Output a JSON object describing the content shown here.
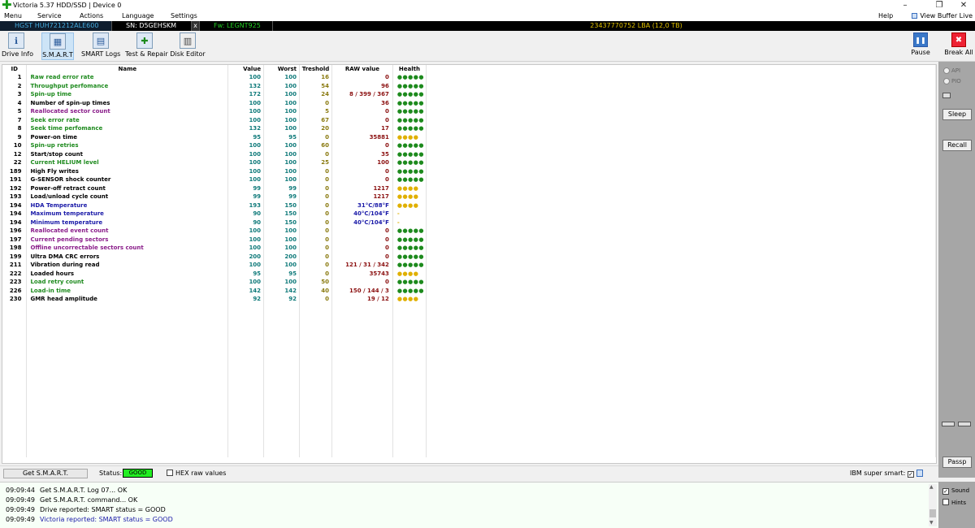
{
  "window": {
    "title": "Victoria 5.37 HDD/SSD | Device 0",
    "controls": {
      "minimize": "–",
      "maximize": "❐",
      "close": "✕"
    }
  },
  "menu": {
    "items": [
      "Menu",
      "Service",
      "Actions",
      "Language",
      "Settings"
    ],
    "help": "Help",
    "view_buffer": "View Buffer Live"
  },
  "device": {
    "model": "HGST HUH721212ALE600",
    "serial": "SN: D5GEHSKM",
    "close": "x",
    "firmware": "Fw: LEGNT925",
    "capacity": "23437770752 LBA (12,0 TB)"
  },
  "toolbar": {
    "buttons": [
      "Drive Info",
      "S.M.A.R.T",
      "SMART Logs",
      "Test & Repair",
      "Disk Editor"
    ],
    "pause": "Pause",
    "break_all": "Break All"
  },
  "table": {
    "headers": [
      "ID",
      "Name",
      "Value",
      "Worst",
      "Treshold",
      "RAW value",
      "Health"
    ],
    "rows": [
      {
        "id": "1",
        "name": "Raw read error rate",
        "value": "100",
        "worst": "100",
        "treshold": "16",
        "raw": "0",
        "health": "●●●●●"
      },
      {
        "id": "2",
        "name": "Throughput perfomance",
        "value": "132",
        "worst": "100",
        "treshold": "54",
        "raw": "96",
        "health": "●●●●●"
      },
      {
        "id": "3",
        "name": "Spin-up time",
        "value": "172",
        "worst": "100",
        "treshold": "24",
        "raw": "8 / 399 / 367",
        "health": "●●●●●"
      },
      {
        "id": "4",
        "name": "Number of spin-up times",
        "value": "100",
        "worst": "100",
        "treshold": "0",
        "raw": "36",
        "health": "●●●●●"
      },
      {
        "id": "5",
        "name": "Reallocated sector count",
        "value": "100",
        "worst": "100",
        "treshold": "5",
        "raw": "0",
        "health": "●●●●●"
      },
      {
        "id": "7",
        "name": "Seek error rate",
        "value": "100",
        "worst": "100",
        "treshold": "67",
        "raw": "0",
        "health": "●●●●●"
      },
      {
        "id": "8",
        "name": "Seek time perfomance",
        "value": "132",
        "worst": "100",
        "treshold": "20",
        "raw": "17",
        "health": "●●●●●"
      },
      {
        "id": "9",
        "name": "Power-on time",
        "value": "95",
        "worst": "95",
        "treshold": "0",
        "raw": "35881",
        "health": "●●●●"
      },
      {
        "id": "10",
        "name": "Spin-up retries",
        "value": "100",
        "worst": "100",
        "treshold": "60",
        "raw": "0",
        "health": "●●●●●"
      },
      {
        "id": "12",
        "name": "Start/stop count",
        "value": "100",
        "worst": "100",
        "treshold": "0",
        "raw": "35",
        "health": "●●●●●"
      },
      {
        "id": "22",
        "name": "Current HELIUM level",
        "value": "100",
        "worst": "100",
        "treshold": "25",
        "raw": "100",
        "health": "●●●●●"
      },
      {
        "id": "189",
        "name": "High Fly writes",
        "value": "100",
        "worst": "100",
        "treshold": "0",
        "raw": "0",
        "health": "●●●●●"
      },
      {
        "id": "191",
        "name": "G-SENSOR shock counter",
        "value": "100",
        "worst": "100",
        "treshold": "0",
        "raw": "0",
        "health": "●●●●●"
      },
      {
        "id": "192",
        "name": "Power-off retract count",
        "value": "99",
        "worst": "99",
        "treshold": "0",
        "raw": "1217",
        "health": "●●●●"
      },
      {
        "id": "193",
        "name": "Load/unload cycle count",
        "value": "99",
        "worst": "99",
        "treshold": "0",
        "raw": "1217",
        "health": "●●●●"
      },
      {
        "id": "194",
        "name": "HDA Temperature",
        "value": "193",
        "worst": "150",
        "treshold": "0",
        "raw": "31°C/88°F",
        "health": "●●●●"
      },
      {
        "id": "194",
        "name": "Maximum temperature",
        "value": "90",
        "worst": "150",
        "treshold": "0",
        "raw": "40°C/104°F",
        "health": "-"
      },
      {
        "id": "194",
        "name": "Minimum temperature",
        "value": "90",
        "worst": "150",
        "treshold": "0",
        "raw": "40°C/104°F",
        "health": "-"
      },
      {
        "id": "196",
        "name": "Reallocated event count",
        "value": "100",
        "worst": "100",
        "treshold": "0",
        "raw": "0",
        "health": "●●●●●"
      },
      {
        "id": "197",
        "name": "Current pending sectors",
        "value": "100",
        "worst": "100",
        "treshold": "0",
        "raw": "0",
        "health": "●●●●●"
      },
      {
        "id": "198",
        "name": "Offline uncorrectable sectors count",
        "value": "100",
        "worst": "100",
        "treshold": "0",
        "raw": "0",
        "health": "●●●●●"
      },
      {
        "id": "199",
        "name": "Ultra DMA CRC errors",
        "value": "200",
        "worst": "200",
        "treshold": "0",
        "raw": "0",
        "health": "●●●●●"
      },
      {
        "id": "211",
        "name": "Vibration during read",
        "value": "100",
        "worst": "100",
        "treshold": "0",
        "raw": "121 / 31 / 342",
        "health": "●●●●●"
      },
      {
        "id": "222",
        "name": "Loaded hours",
        "value": "95",
        "worst": "95",
        "treshold": "0",
        "raw": "35743",
        "health": "●●●●"
      },
      {
        "id": "223",
        "name": "Load retry count",
        "value": "100",
        "worst": "100",
        "treshold": "50",
        "raw": "0",
        "health": "●●●●●"
      },
      {
        "id": "226",
        "name": "Load-in time",
        "value": "142",
        "worst": "142",
        "treshold": "40",
        "raw": "150 / 144 / 3",
        "health": "●●●●●"
      },
      {
        "id": "230",
        "name": "GMR head amplitude",
        "value": "92",
        "worst": "92",
        "treshold": "0",
        "raw": "19 / 12",
        "health": "●●●●"
      }
    ]
  },
  "side": {
    "api": "API",
    "pio": "PIO",
    "sleep": "Sleep",
    "recall": "Recall",
    "passp": "Passp"
  },
  "status": {
    "get_smart": "Get S.M.A.R.T.",
    "status_label": "Status:",
    "status_value": "GOOD",
    "hex_raw": "HEX raw values",
    "ibm_super_smart": "IBM super smart:"
  },
  "log": [
    {
      "time": "09:09:44",
      "text": "Get S.M.A.R.T. Log 07... OK"
    },
    {
      "time": "09:09:49",
      "text": "Get S.M.A.R.T. command... OK"
    },
    {
      "time": "09:09:49",
      "text": "Drive reported: SMART status = GOOD"
    },
    {
      "time": "09:09:49",
      "text": "Victoria reported: SMART status = GOOD"
    }
  ],
  "log_options": {
    "sound": "Sound",
    "hints": "Hints"
  }
}
